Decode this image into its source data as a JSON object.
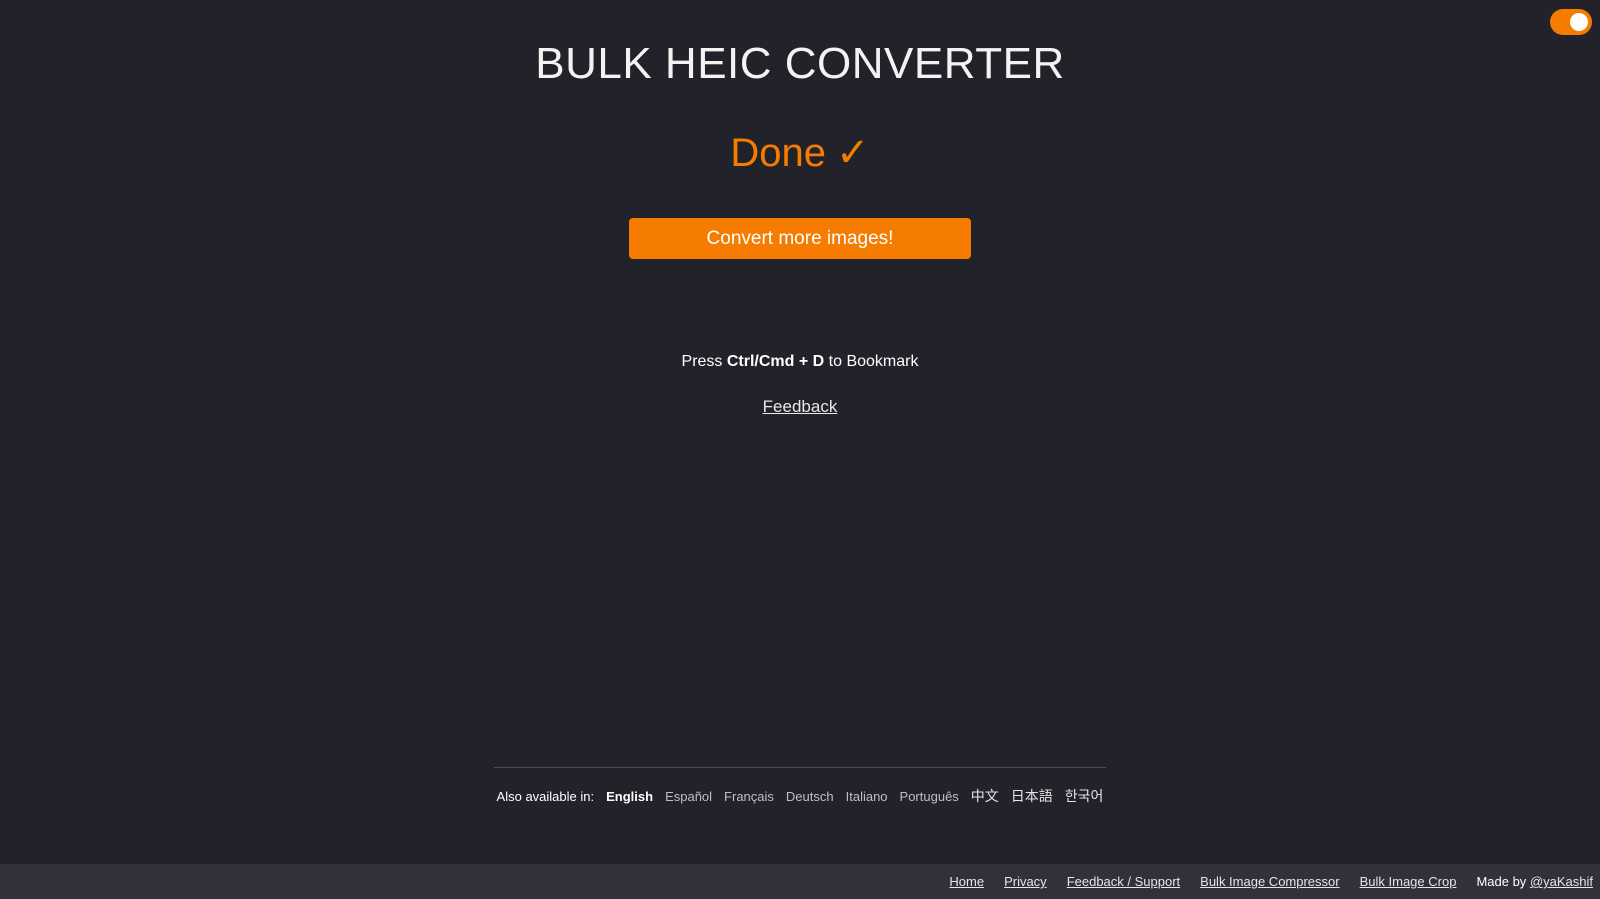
{
  "header": {
    "title": "BULK HEIC CONVERTER",
    "theme_toggle": "toggle-icon"
  },
  "status": {
    "text": "Done",
    "check_glyph": "✓"
  },
  "actions": {
    "convert_more_label": "Convert more images!"
  },
  "bookmark": {
    "prefix": "Press",
    "keys": "Ctrl/Cmd + D",
    "suffix": "to Bookmark"
  },
  "feedback_label": "Feedback",
  "languages": {
    "label": "Also available in:",
    "items": [
      "English",
      "Español",
      "Français",
      "Deutsch",
      "Italiano",
      "Português",
      "中文",
      "日本語",
      "한국어"
    ],
    "active": "English"
  },
  "footer": {
    "links": [
      "Home",
      "Privacy",
      "Feedback / Support",
      "Bulk Image Compressor",
      "Bulk Image Crop"
    ],
    "made_by_prefix": "Made by",
    "made_by_handle": "@yaKashif"
  },
  "colors": {
    "accent": "#f57c00",
    "background": "#21222a",
    "footer_bg": "#30313a"
  }
}
